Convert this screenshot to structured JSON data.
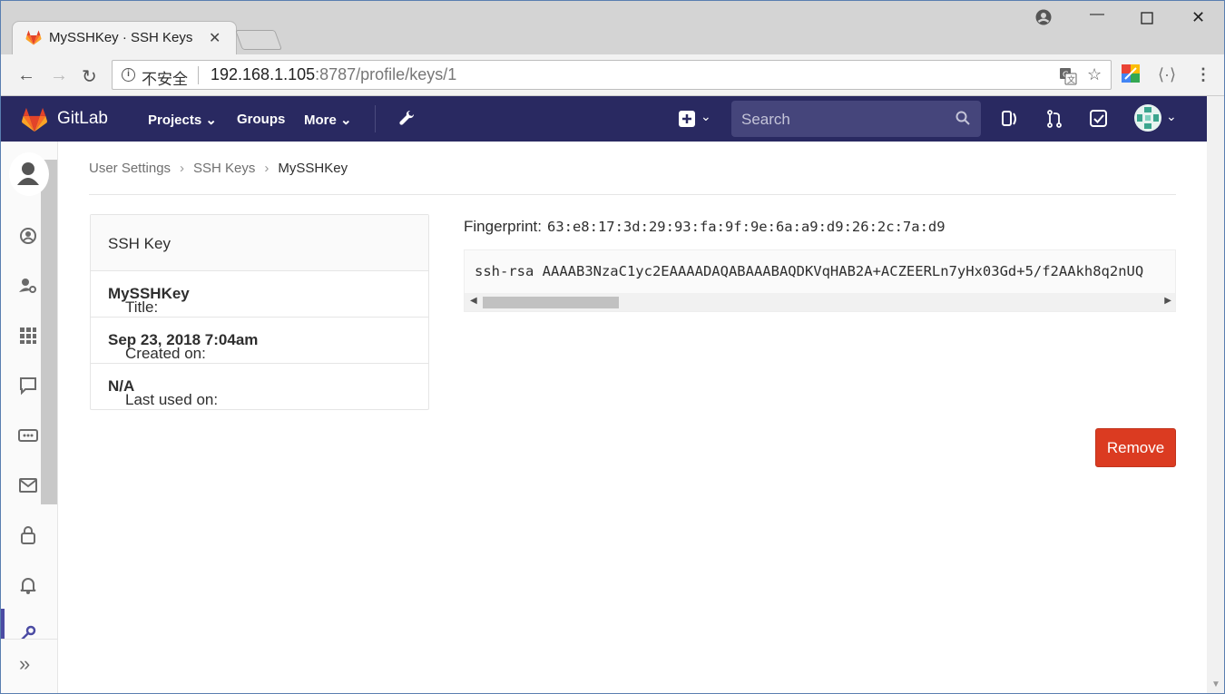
{
  "browser": {
    "tab_title": "MySSHKey · SSH Keys ·",
    "security_label": "不安全",
    "url_host": "192.168.1.105",
    "url_rest": ":8787/profile/keys/1"
  },
  "header": {
    "brand": "GitLab",
    "nav": {
      "projects": "Projects",
      "groups": "Groups",
      "more": "More"
    },
    "search_placeholder": "Search"
  },
  "breadcrumb": {
    "items": [
      "User Settings",
      "SSH Keys",
      "MySSHKey"
    ]
  },
  "card": {
    "heading": "SSH Key",
    "title_label": "Title:",
    "title_value": "MySSHKey",
    "created_label": "Created on:",
    "created_value": "Sep 23, 2018 7:04am",
    "last_used_label": "Last used on:",
    "last_used_value": "N/A"
  },
  "fingerprint": {
    "label": "Fingerprint:",
    "value": "63:e8:17:3d:29:93:fa:9f:9e:6a:a9:d9:26:2c:7a:d9"
  },
  "key": {
    "text": "ssh-rsa AAAAB3NzaC1yc2EAAAADAQABAAABAQDKVqHAB2A+ACZEERLn7yHx03Gd+5/f2AAkh8q2nUQ"
  },
  "actions": {
    "remove_label": "Remove"
  },
  "colors": {
    "header_bg": "#292961",
    "remove_bg": "#db3b21"
  }
}
